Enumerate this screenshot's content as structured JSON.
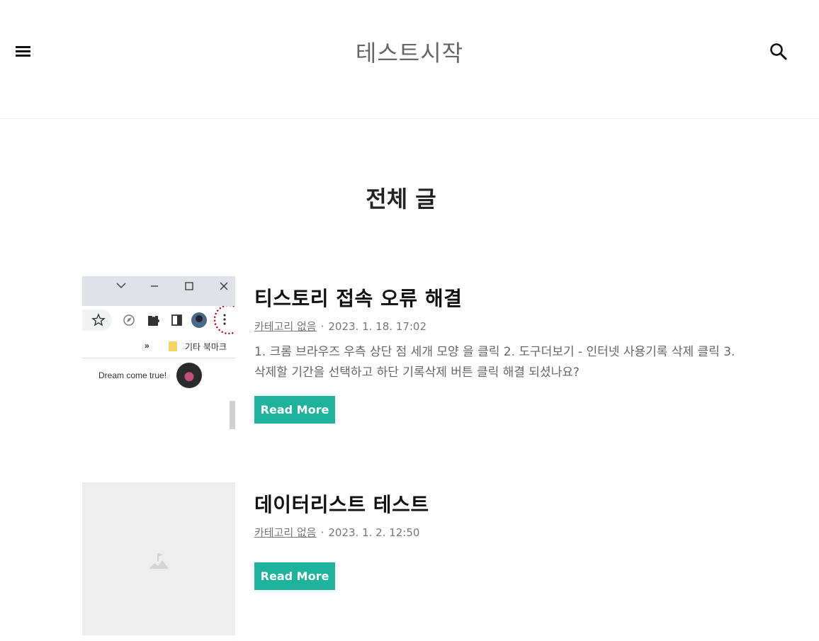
{
  "header": {
    "blog_title": "테스트시작",
    "menu_icon": "menu-icon",
    "search_icon": "search-icon"
  },
  "page": {
    "heading": "전체 글"
  },
  "posts": [
    {
      "title": "티스토리 접속 오류 해결",
      "category": "카테고리 없음",
      "date": "2023. 1. 18. 17:02",
      "excerpt": "1. 크롬 브라우즈 우측 상단 점 세개 모양 을 클릭 2. 도구더보기 - 인터넷 사용기록 삭제 클릭 3. 삭제할 기간을 선택하고 하단 기록삭제 버튼 클릭 해결 되셨나요?",
      "read_more": "Read More",
      "thumbnail": {
        "bookmark_label": "기타 북마크",
        "chevron": "»",
        "caption": "Dream come true!"
      }
    },
    {
      "title": "데이터리스트 테스트",
      "category": "카테고리 없음",
      "date": "2023. 1. 2. 12:50",
      "excerpt": "",
      "read_more": "Read More"
    }
  ],
  "colors": {
    "accent": "#1fb39d",
    "title_gray": "#666666",
    "placeholder_bg": "#eeeeee"
  }
}
